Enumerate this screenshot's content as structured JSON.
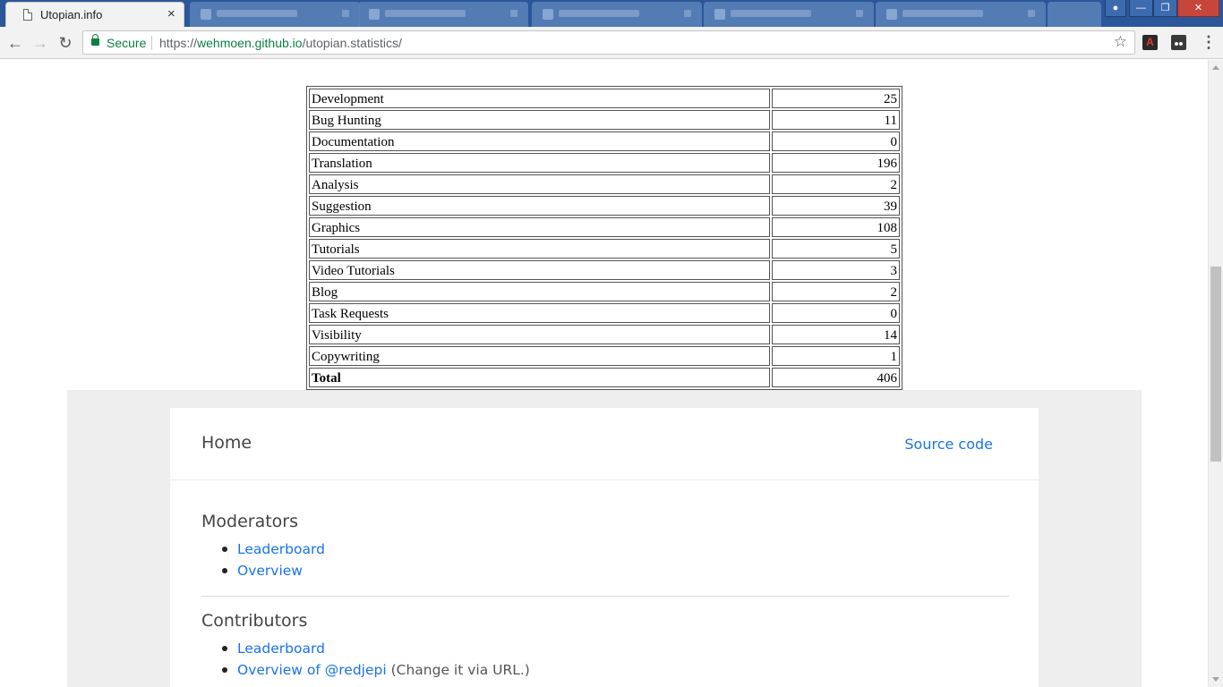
{
  "browser": {
    "active_tab": {
      "title": "Utopian.info",
      "close": "×"
    },
    "window_controls": {
      "minimize": "—",
      "maximize": "❐",
      "close": "✕"
    },
    "nav": {
      "back": "←",
      "forward": "→",
      "reload": "↻"
    },
    "omnibox": {
      "secure_label": "Secure",
      "url_scheme": "https://",
      "url_host": "wehmoen.github.io",
      "url_path": "/utopian.statistics/",
      "star": "☆"
    },
    "extensions": {
      "pdf": "A",
      "menu": "⋮"
    }
  },
  "stats_table": {
    "rows": [
      {
        "label": "Development",
        "value": "25"
      },
      {
        "label": "Bug Hunting",
        "value": "11"
      },
      {
        "label": "Documentation",
        "value": "0"
      },
      {
        "label": "Translation",
        "value": "196"
      },
      {
        "label": "Analysis",
        "value": "2"
      },
      {
        "label": "Suggestion",
        "value": "39"
      },
      {
        "label": "Graphics",
        "value": "108"
      },
      {
        "label": "Tutorials",
        "value": "5"
      },
      {
        "label": "Video Tutorials",
        "value": "3"
      },
      {
        "label": "Blog",
        "value": "2"
      },
      {
        "label": "Task Requests",
        "value": "0"
      },
      {
        "label": "Visibility",
        "value": "14"
      },
      {
        "label": "Copywriting",
        "value": "1"
      }
    ],
    "total": {
      "label": "Total",
      "value": "406"
    }
  },
  "card": {
    "home_title": "Home",
    "source_code_link": "Source code",
    "moderators": {
      "title": "Moderators",
      "links": [
        "Leaderboard",
        "Overview"
      ]
    },
    "contributors": {
      "title": "Contributors",
      "leaderboard": "Leaderboard",
      "overview_link": "Overview of @redjepi",
      "overview_note": " (Change it via URL.)"
    }
  }
}
